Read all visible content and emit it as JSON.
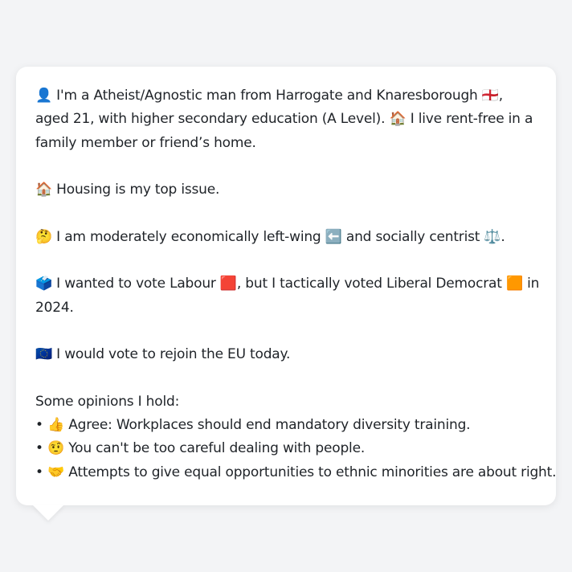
{
  "message": {
    "intro": {
      "icon1": "👤",
      "text1": " I'm a Atheist/Agnostic man from Harrogate and Knaresborough ",
      "flag": "🏴󠁧󠁢󠁥󠁮󠁧󠁿",
      "text2": ", aged 21, with higher secondary education (A Level). ",
      "icon2": "🏠",
      "text3": " I live rent-free in a family member or friend’s home."
    },
    "top_issue": {
      "icon": "🏠",
      "text": " Housing is my top issue."
    },
    "ideology": {
      "icon": "🤔",
      "text1": " I am moderately economically left-wing ",
      "icon_left": "⬅️",
      "text2": " and socially centrist ",
      "icon_scale": "⚖️",
      "text3": "."
    },
    "vote": {
      "icon": "🗳️",
      "text1": " I wanted to vote Labour ",
      "labour_square": "🟥",
      "text2": ", but I tactically voted Liberal Democrat ",
      "libdem_square": "🟧",
      "text3": " in 2024."
    },
    "eu": {
      "icon": "🇪🇺",
      "text": " I would vote to rejoin the EU today."
    },
    "opinions": {
      "heading": "Some opinions I hold:",
      "items": [
        {
          "bullet": "•",
          "icon": "👍",
          "text": " Agree: Workplaces should end mandatory diversity training."
        },
        {
          "bullet": "•",
          "icon": "🤨",
          "text": " You can't be too careful dealing with people."
        },
        {
          "bullet": "•",
          "icon": "🤝",
          "text": " Attempts to give equal opportunities to ethnic minorities are about right."
        }
      ]
    }
  }
}
